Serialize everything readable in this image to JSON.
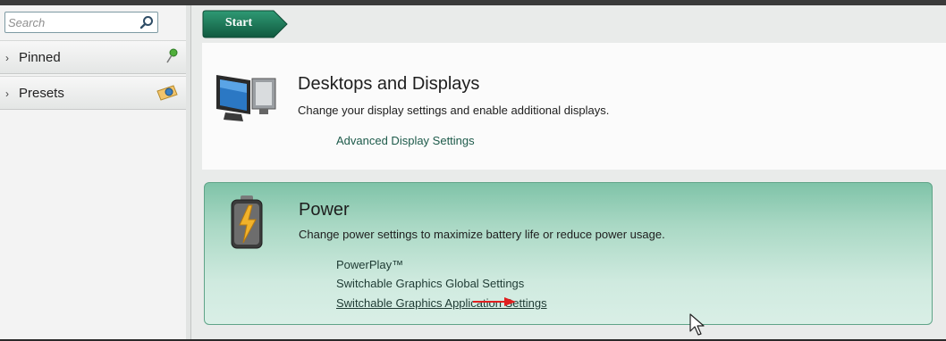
{
  "search": {
    "placeholder": "Search"
  },
  "sidebar": {
    "items": [
      {
        "label": "Pinned",
        "icon": "pin-icon"
      },
      {
        "label": "Presets",
        "icon": "presets-icon"
      }
    ]
  },
  "toolbar": {
    "start_label": "Start"
  },
  "sections": [
    {
      "title": "Desktops and Displays",
      "description": "Change your display settings and enable additional displays.",
      "icon": "monitor-icon",
      "links": [
        "Advanced Display Settings"
      ]
    },
    {
      "title": "Power",
      "description": "Change power settings to maximize battery life or reduce power usage.",
      "icon": "battery-icon",
      "links": [
        "PowerPlay™",
        "Switchable Graphics Global Settings",
        "Switchable Graphics Application Settings"
      ]
    }
  ],
  "colors": {
    "accent": "#1f7a5c",
    "link": "#1d5a4a",
    "card_border": "#5fa488",
    "annotation_arrow": "#e02020"
  }
}
